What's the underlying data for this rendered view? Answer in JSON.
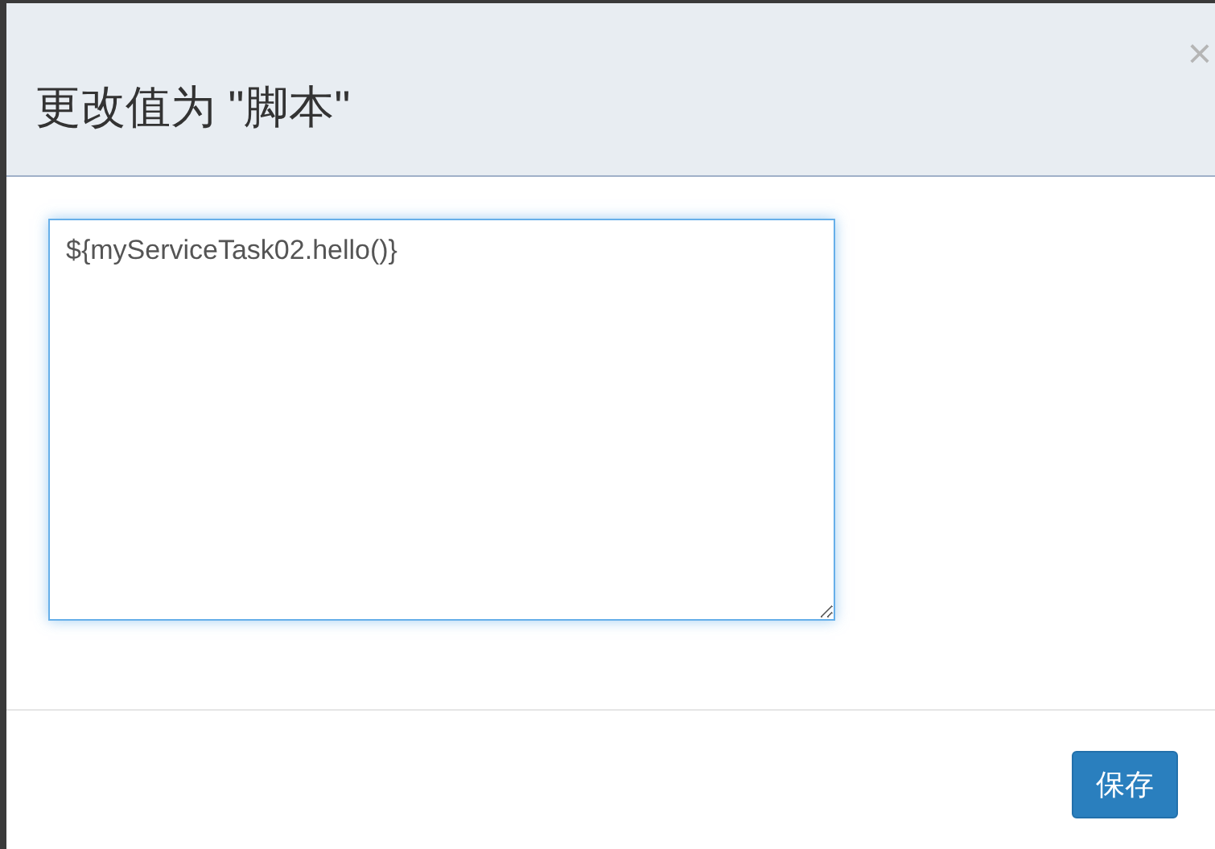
{
  "dialog": {
    "title": "更改值为 \"脚本\"",
    "close": "×"
  },
  "field": {
    "value": "${myServiceTask02.hello()}"
  },
  "buttons": [
    {
      "label": "保存",
      "kind": "primary"
    }
  ]
}
